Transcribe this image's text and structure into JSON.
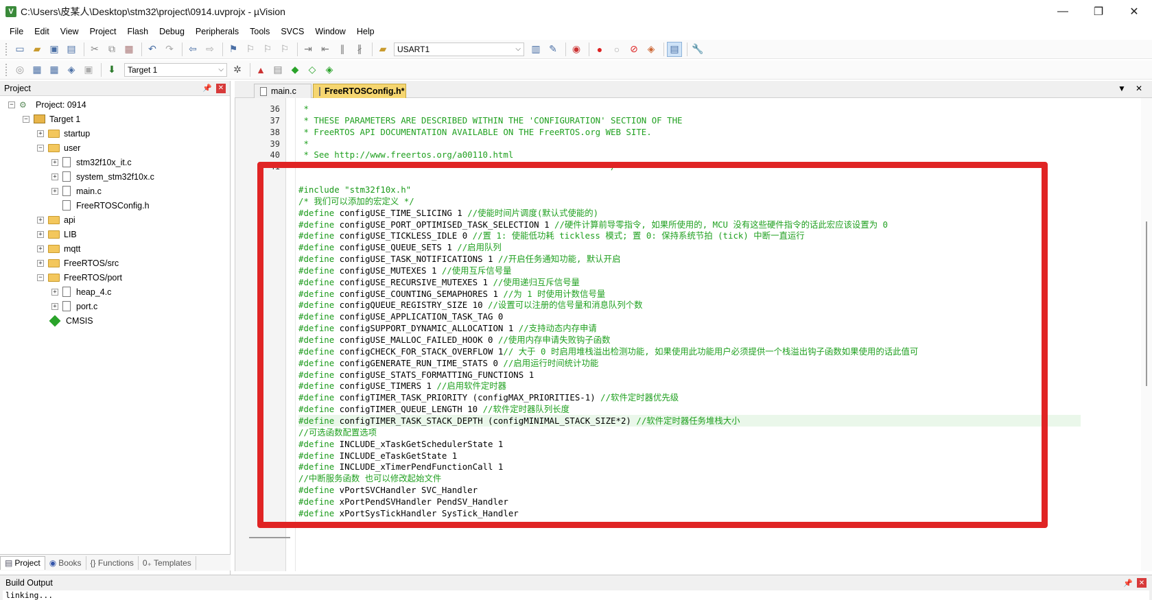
{
  "window": {
    "title": "C:\\Users\\皮某人\\Desktop\\stm32\\project\\0914.uvprojx - µVision",
    "app_icon": "V",
    "controls": {
      "minimize": "—",
      "restore": "❐",
      "close": "✕"
    }
  },
  "menu": [
    "File",
    "Edit",
    "View",
    "Project",
    "Flash",
    "Debug",
    "Peripherals",
    "Tools",
    "SVCS",
    "Window",
    "Help"
  ],
  "toolbar1": {
    "find_combo_value": "USART1",
    "icons": [
      "new-file-icon",
      "open-folder-icon",
      "save-icon",
      "save-all-icon",
      "cut-icon",
      "copy-icon",
      "paste-icon",
      "undo-icon",
      "redo-icon",
      "navigate-back-icon",
      "navigate-forward-icon",
      "bookmark-icon",
      "prev-bookmark-icon",
      "next-bookmark-icon",
      "clear-bookmarks-icon",
      "indent-icon",
      "unindent-icon",
      "comment-icon",
      "uncomment-icon",
      "find-in-files-icon",
      "find-icon",
      "incremental-find-icon",
      "debug-session-icon",
      "breakpoint-icon",
      "disable-breakpoint-icon",
      "kill-breakpoints-icon",
      "window-layout-icon",
      "configure-icon"
    ]
  },
  "toolbar2": {
    "target_combo_value": "Target 1",
    "icons": [
      "translate-icon",
      "build-icon",
      "rebuild-icon",
      "batch-build-icon",
      "stop-build-icon",
      "download-icon",
      "target-options-icon",
      "manage-components-icon",
      "run-time-env-icon",
      "pack-installer-icon",
      "select-packs-icon"
    ]
  },
  "project_panel": {
    "title": "Project",
    "tree": [
      {
        "label": "Project: 0914",
        "depth": 0,
        "expander": "−",
        "kind": "project"
      },
      {
        "label": "Target 1",
        "depth": 1,
        "expander": "−",
        "kind": "target"
      },
      {
        "label": "startup",
        "depth": 2,
        "expander": "+",
        "kind": "folder"
      },
      {
        "label": "user",
        "depth": 2,
        "expander": "−",
        "kind": "folder"
      },
      {
        "label": "stm32f10x_it.c",
        "depth": 3,
        "expander": "+",
        "kind": "file"
      },
      {
        "label": "system_stm32f10x.c",
        "depth": 3,
        "expander": "+",
        "kind": "file"
      },
      {
        "label": "main.c",
        "depth": 3,
        "expander": "+",
        "kind": "file"
      },
      {
        "label": "FreeRTOSConfig.h",
        "depth": 3,
        "expander": "",
        "kind": "file"
      },
      {
        "label": "api",
        "depth": 2,
        "expander": "+",
        "kind": "folder"
      },
      {
        "label": "LIB",
        "depth": 2,
        "expander": "+",
        "kind": "folder"
      },
      {
        "label": "mqtt",
        "depth": 2,
        "expander": "+",
        "kind": "folder"
      },
      {
        "label": "FreeRTOS/src",
        "depth": 2,
        "expander": "+",
        "kind": "folder"
      },
      {
        "label": "FreeRTOS/port",
        "depth": 2,
        "expander": "−",
        "kind": "folder"
      },
      {
        "label": "heap_4.c",
        "depth": 3,
        "expander": "+",
        "kind": "file"
      },
      {
        "label": "port.c",
        "depth": 3,
        "expander": "+",
        "kind": "file"
      },
      {
        "label": "CMSIS",
        "depth": 2,
        "expander": "",
        "kind": "component"
      }
    ],
    "bottom_tabs": [
      "Project",
      "Books",
      "{} Functions",
      "0₊ Templates"
    ]
  },
  "editor": {
    "tabs": [
      {
        "label": "main.c",
        "active": false
      },
      {
        "label": "FreeRTOSConfig.h*",
        "active": true
      }
    ],
    "lines": [
      {
        "n": "36",
        "text": " *",
        "style": "cm"
      },
      {
        "n": "37",
        "text": " * THESE PARAMETERS ARE DESCRIBED WITHIN THE 'CONFIGURATION' SECTION OF THE",
        "style": "cm"
      },
      {
        "n": "38",
        "text": " * FreeRTOS API DOCUMENTATION AVAILABLE ON THE FreeRTOS.org WEB SITE.",
        "style": "cm"
      },
      {
        "n": "39",
        "text": " *",
        "style": "cm"
      },
      {
        "n": "40",
        "text": " * See http://www.freertos.org/a00110.html",
        "style": "cm"
      },
      {
        "n": "41",
        "text": " *----------------------------------------------------------*/",
        "style": "cm"
      },
      {
        "n": "",
        "text": "",
        "style": ""
      },
      {
        "n": "",
        "text": "#include \"stm32f10x.h\"",
        "style": "pp"
      },
      {
        "n": "",
        "text": "/* 我们可以添加的宏定义 */",
        "style": "cm"
      },
      {
        "n": "",
        "pp": "#define",
        "code": " configUSE_TIME_SLICING 1 ",
        "comment": "//使能时间片调度(默认式使能的)"
      },
      {
        "n": "",
        "pp": "#define",
        "code": " configUSE_PORT_OPTIMISED_TASK_SELECTION 1 ",
        "comment": "//硬件计算前导零指令, 如果所使用的, MCU 没有这些硬件指令的话此宏应该设置为 0"
      },
      {
        "n": "",
        "pp": "#define",
        "code": " configUSE_TICKLESS_IDLE 0 ",
        "comment": "//置 1: 使能低功耗 tickless 模式; 置 0: 保持系统节拍 (tick) 中断一直运行"
      },
      {
        "n": "",
        "pp": "#define",
        "code": " configUSE_QUEUE_SETS 1 ",
        "comment": "//启用队列"
      },
      {
        "n": "",
        "pp": "#define",
        "code": " configUSE_TASK_NOTIFICATIONS 1 ",
        "comment": "//开启任务通知功能, 默认开启"
      },
      {
        "n": "",
        "pp": "#define",
        "code": " configUSE_MUTEXES 1 ",
        "comment": "//使用互斥信号量"
      },
      {
        "n": "",
        "pp": "#define",
        "code": " configUSE_RECURSIVE_MUTEXES 1 ",
        "comment": "//使用递归互斥信号量"
      },
      {
        "n": "",
        "pp": "#define",
        "code": " configUSE_COUNTING_SEMAPHORES 1 ",
        "comment": "//为 1 时使用计数信号量"
      },
      {
        "n": "",
        "pp": "#define",
        "code": " configQUEUE_REGISTRY_SIZE 10 ",
        "comment": "//设置可以注册的信号量和消息队列个数"
      },
      {
        "n": "",
        "pp": "#define",
        "code": " configUSE_APPLICATION_TASK_TAG 0",
        "comment": ""
      },
      {
        "n": "",
        "pp": "#define",
        "code": " configSUPPORT_DYNAMIC_ALLOCATION 1 ",
        "comment": "//支持动态内存申请"
      },
      {
        "n": "",
        "pp": "#define",
        "code": " configUSE_MALLOC_FAILED_HOOK 0 ",
        "comment": "//使用内存申请失败钩子函数"
      },
      {
        "n": "",
        "pp": "#define",
        "code": " configCHECK_FOR_STACK_OVERFLOW 1",
        "comment": "// 大于 0 时启用堆栈溢出检测功能, 如果使用此功能用户必须提供一个栈溢出钩子函数如果使用的话此值可"
      },
      {
        "n": "",
        "pp": "#define",
        "code": " configGENERATE_RUN_TIME_STATS 0 ",
        "comment": "//启用运行时间统计功能"
      },
      {
        "n": "",
        "pp": "#define",
        "code": " configUSE_STATS_FORMATTING_FUNCTIONS 1",
        "comment": ""
      },
      {
        "n": "",
        "pp": "#define",
        "code": " configUSE_TIMERS 1 ",
        "comment": "//启用软件定时器"
      },
      {
        "n": "",
        "pp": "#define",
        "code": " configTIMER_TASK_PRIORITY (configMAX_PRIORITIES-1) ",
        "comment": "//软件定时器优先级"
      },
      {
        "n": "",
        "pp": "#define",
        "code": " configTIMER_QUEUE_LENGTH 10 ",
        "comment": "//软件定时器队列长度"
      },
      {
        "n": "",
        "pp": "#define",
        "code": " configTIMER_TASK_STACK_DEPTH (configMINIMAL_STACK_SIZE*2) ",
        "comment": "//软件定时器任务堆栈大小",
        "highlight": true
      },
      {
        "n": "",
        "text": "//可选函数配置选项",
        "style": "cm"
      },
      {
        "n": "",
        "pp": "#define",
        "code": " INCLUDE_xTaskGetSchedulerState 1",
        "comment": ""
      },
      {
        "n": "",
        "pp": "#define",
        "code": " INCLUDE_eTaskGetState 1",
        "comment": ""
      },
      {
        "n": "",
        "pp": "#define",
        "code": " INCLUDE_xTimerPendFunctionCall 1",
        "comment": ""
      },
      {
        "n": "",
        "text": "//中断服务函数 也可以修改起始文件",
        "style": "cm"
      },
      {
        "n": "",
        "pp": "#define",
        "code": " vPortSVCHandler SVC_Handler",
        "comment": ""
      },
      {
        "n": "",
        "pp": "#define",
        "code": " xPortPendSVHandler PendSV_Handler",
        "comment": ""
      },
      {
        "n": "",
        "pp": "#define",
        "code": " xPortSysTickHandler SysTick_Handler",
        "comment": ""
      }
    ]
  },
  "build_output": {
    "title": "Build Output",
    "text": "linking..."
  },
  "colors": {
    "annotation_box": "#e02424",
    "comment": "#20a020",
    "active_tab": "#f6d670",
    "highlight_line": "#eaf7ea"
  }
}
